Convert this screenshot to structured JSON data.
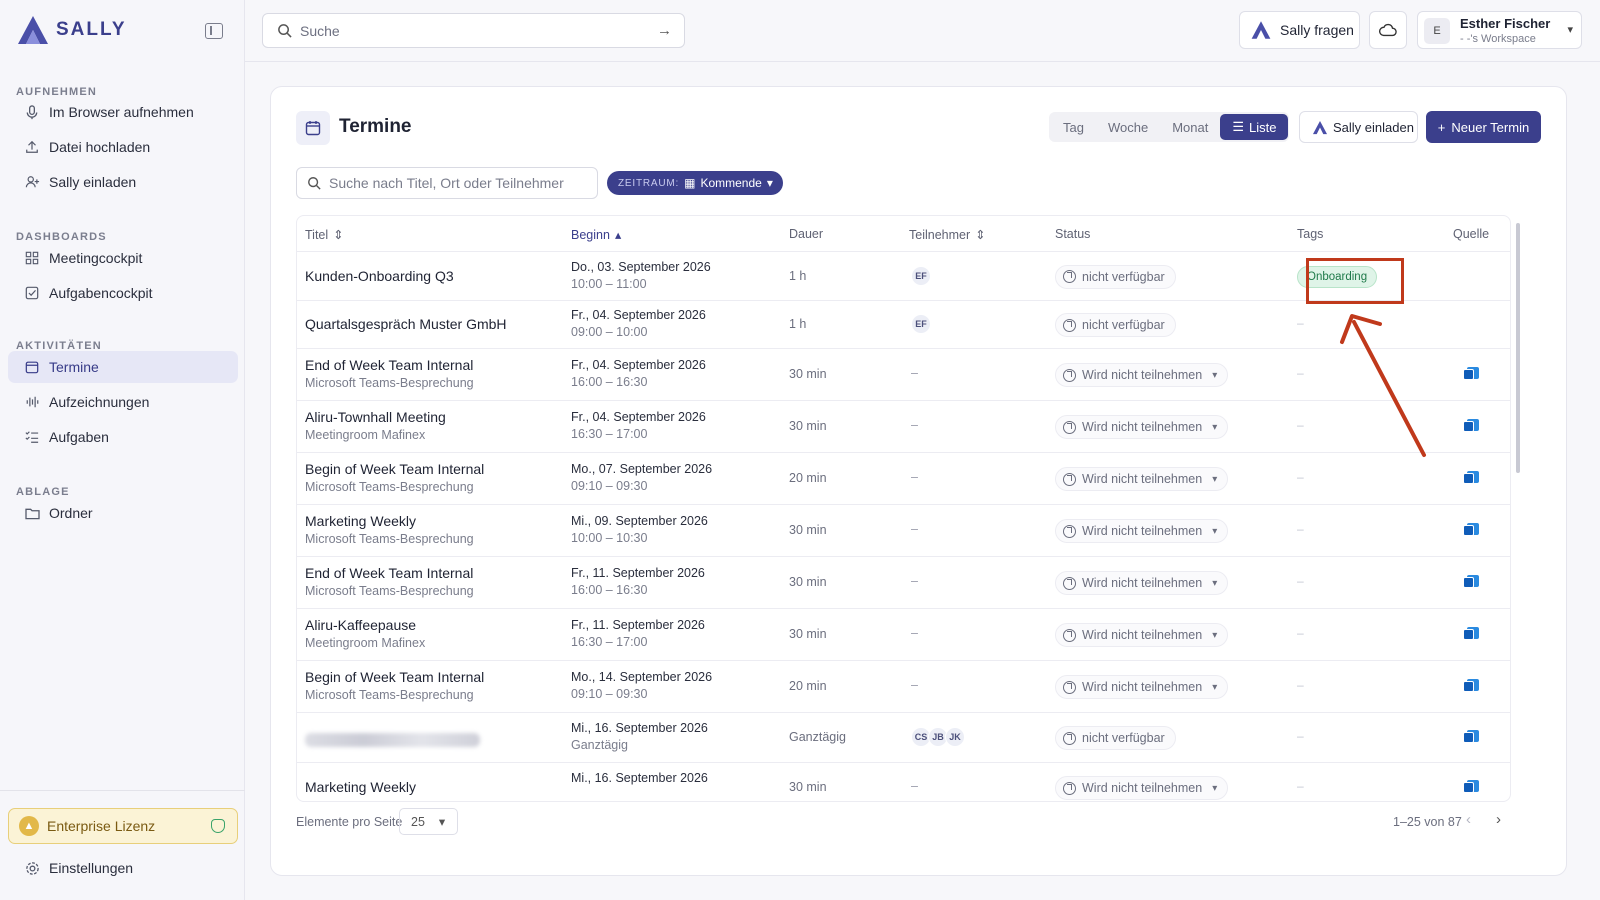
{
  "app": {
    "name": "SALLY"
  },
  "sidebar": {
    "sections": [
      {
        "label": "AUFNEHMEN",
        "items": [
          {
            "label": "Im Browser aufnehmen",
            "icon": "microphone-icon"
          },
          {
            "label": "Datei hochladen",
            "icon": "upload-icon"
          },
          {
            "label": "Sally einladen",
            "icon": "user-plus-icon"
          }
        ]
      },
      {
        "label": "DASHBOARDS",
        "items": [
          {
            "label": "Meetingcockpit",
            "icon": "grid-icon"
          },
          {
            "label": "Aufgabencockpit",
            "icon": "checkbox-icon"
          }
        ]
      },
      {
        "label": "AKTIVITÄTEN",
        "items": [
          {
            "label": "Termine",
            "icon": "calendar-icon",
            "active": true
          },
          {
            "label": "Aufzeichnungen",
            "icon": "waveform-icon"
          },
          {
            "label": "Aufgaben",
            "icon": "checklist-icon"
          }
        ]
      },
      {
        "label": "ABLAGE",
        "items": [
          {
            "label": "Ordner",
            "icon": "folder-icon"
          }
        ]
      }
    ],
    "license": "Enterprise Lizenz",
    "settings": "Einstellungen"
  },
  "topbar": {
    "search_placeholder": "Suche",
    "ask_label": "Sally fragen",
    "user": {
      "initial": "E",
      "name": "Esther Fischer",
      "workspace": "- -'s Workspace"
    }
  },
  "page": {
    "title": "Termine",
    "views": [
      "Tag",
      "Woche",
      "Monat",
      "Liste"
    ],
    "active_view": "Liste",
    "invite_label": "Sally einladen",
    "new_label": "Neuer Termin",
    "filter_placeholder": "Suche nach Titel, Ort oder Teilnehmer",
    "period_label": "ZEITRAUM:",
    "period_value": "Kommende"
  },
  "table": {
    "columns": [
      "Titel",
      "Beginn",
      "Dauer",
      "Teilnehmer",
      "Status",
      "Tags",
      "Quelle"
    ],
    "rows": [
      {
        "title": "Kunden-Onboarding Q3",
        "sub": "",
        "date": "Do., 03. September 2026",
        "time": "10:00 – 11:00",
        "duration": "1 h",
        "participants": [
          "EF"
        ],
        "status": "nicht verfügbar",
        "status_dropdown": false,
        "tag": "Onboarding",
        "source": ""
      },
      {
        "title": "Quartalsgespräch Muster GmbH",
        "sub": "",
        "date": "Fr., 04. September 2026",
        "time": "09:00 – 10:00",
        "duration": "1 h",
        "participants": [
          "EF"
        ],
        "status": "nicht verfügbar",
        "status_dropdown": false,
        "tag": "",
        "source": ""
      },
      {
        "title": "End of Week Team Internal",
        "sub": "Microsoft Teams-Besprechung",
        "date": "Fr., 04. September 2026",
        "time": "16:00 – 16:30",
        "duration": "30 min",
        "participants": [],
        "status": "Wird nicht teilnehmen",
        "status_dropdown": true,
        "tag": "",
        "source": "outlook"
      },
      {
        "title": "Aliru-Townhall Meeting",
        "sub": "Meetingroom Mafinex",
        "date": "Fr., 04. September 2026",
        "time": "16:30 – 17:00",
        "duration": "30 min",
        "participants": [],
        "status": "Wird nicht teilnehmen",
        "status_dropdown": true,
        "tag": "",
        "source": "outlook"
      },
      {
        "title": "Begin of Week Team Internal",
        "sub": "Microsoft Teams-Besprechung",
        "date": "Mo., 07. September 2026",
        "time": "09:10 – 09:30",
        "duration": "20 min",
        "participants": [],
        "status": "Wird nicht teilnehmen",
        "status_dropdown": true,
        "tag": "",
        "source": "outlook"
      },
      {
        "title": "Marketing Weekly",
        "sub": "Microsoft Teams-Besprechung",
        "date": "Mi., 09. September 2026",
        "time": "10:00 – 10:30",
        "duration": "30 min",
        "participants": [],
        "status": "Wird nicht teilnehmen",
        "status_dropdown": true,
        "tag": "",
        "source": "outlook"
      },
      {
        "title": "End of Week Team Internal",
        "sub": "Microsoft Teams-Besprechung",
        "date": "Fr., 11. September 2026",
        "time": "16:00 – 16:30",
        "duration": "30 min",
        "participants": [],
        "status": "Wird nicht teilnehmen",
        "status_dropdown": true,
        "tag": "",
        "source": "outlook"
      },
      {
        "title": "Aliru-Kaffeepause",
        "sub": "Meetingroom Mafinex",
        "date": "Fr., 11. September 2026",
        "time": "16:30 – 17:00",
        "duration": "30 min",
        "participants": [],
        "status": "Wird nicht teilnehmen",
        "status_dropdown": true,
        "tag": "",
        "source": "outlook"
      },
      {
        "title": "Begin of Week Team Internal",
        "sub": "Microsoft Teams-Besprechung",
        "date": "Mo., 14. September 2026",
        "time": "09:10 – 09:30",
        "duration": "20 min",
        "participants": [],
        "status": "Wird nicht teilnehmen",
        "status_dropdown": true,
        "tag": "",
        "source": "outlook"
      },
      {
        "title": "",
        "blurred": true,
        "sub": "",
        "date": "Mi., 16. September 2026",
        "time": "Ganztägig",
        "duration": "Ganztägig",
        "participants": [
          "CS",
          "JB",
          "JK"
        ],
        "status": "nicht verfügbar",
        "status_dropdown": false,
        "tag": "",
        "source": "outlook"
      },
      {
        "title": "Marketing Weekly",
        "sub": "",
        "date": "Mi., 16. September 2026",
        "time": "",
        "duration": "30 min",
        "participants": [],
        "status": "Wird nicht teilnehmen",
        "status_dropdown": true,
        "tag": "",
        "source": "outlook"
      }
    ],
    "empty_value": "–"
  },
  "footer": {
    "per_page_label": "Elemente pro Seite",
    "per_page_value": "25",
    "range": "1–25 von 87"
  },
  "colors": {
    "accent": "#3b3f8c",
    "annotation": "#c0391b",
    "tag_bg": "#dff4e8"
  }
}
